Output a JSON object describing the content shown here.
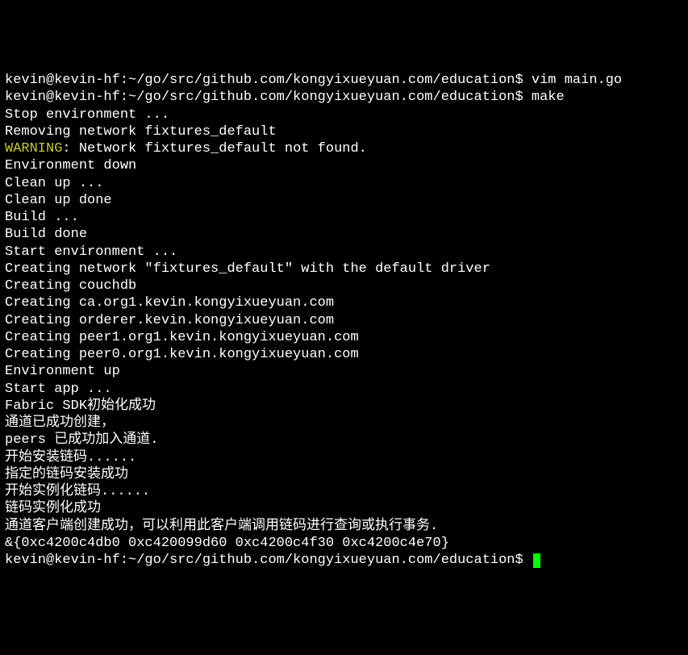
{
  "lines": [
    {
      "type": "prompt",
      "prompt": "kevin@kevin-hf:~/go/src/github.com/kongyixueyuan.com/education$ ",
      "cmd": "vim main.go"
    },
    {
      "type": "prompt",
      "prompt": "kevin@kevin-hf:~/go/src/github.com/kongyixueyuan.com/education$ ",
      "cmd": "make"
    },
    {
      "type": "text",
      "text": "Stop environment ..."
    },
    {
      "type": "text",
      "text": "Removing network fixtures_default"
    },
    {
      "type": "warning",
      "label": "WARNING",
      "text": ": Network fixtures_default not found."
    },
    {
      "type": "text",
      "text": "Environment down"
    },
    {
      "type": "text",
      "text": "Clean up ..."
    },
    {
      "type": "text",
      "text": "Clean up done"
    },
    {
      "type": "text",
      "text": "Build ..."
    },
    {
      "type": "text",
      "text": "Build done"
    },
    {
      "type": "text",
      "text": "Start environment ..."
    },
    {
      "type": "text",
      "text": "Creating network \"fixtures_default\" with the default driver"
    },
    {
      "type": "text",
      "text": "Creating couchdb"
    },
    {
      "type": "text",
      "text": "Creating ca.org1.kevin.kongyixueyuan.com"
    },
    {
      "type": "text",
      "text": "Creating orderer.kevin.kongyixueyuan.com"
    },
    {
      "type": "text",
      "text": "Creating peer1.org1.kevin.kongyixueyuan.com"
    },
    {
      "type": "text",
      "text": "Creating peer0.org1.kevin.kongyixueyuan.com"
    },
    {
      "type": "text",
      "text": "Environment up"
    },
    {
      "type": "text",
      "text": "Start app ..."
    },
    {
      "type": "text",
      "text": "Fabric SDK初始化成功"
    },
    {
      "type": "text",
      "text": "通道已成功创建，"
    },
    {
      "type": "text",
      "text": "peers 已成功加入通道."
    },
    {
      "type": "text",
      "text": "开始安装链码......"
    },
    {
      "type": "text",
      "text": "指定的链码安装成功"
    },
    {
      "type": "text",
      "text": "开始实例化链码......"
    },
    {
      "type": "text",
      "text": "链码实例化成功"
    },
    {
      "type": "text",
      "text": "通道客户端创建成功，可以利用此客户端调用链码进行查询或执行事务."
    },
    {
      "type": "text",
      "text": "&{0xc4200c4db0 0xc420099d60 0xc4200c4f30 0xc4200c4e70}"
    },
    {
      "type": "prompt-cursor",
      "prompt": "kevin@kevin-hf:~/go/src/github.com/kongyixueyuan.com/education$ "
    }
  ]
}
